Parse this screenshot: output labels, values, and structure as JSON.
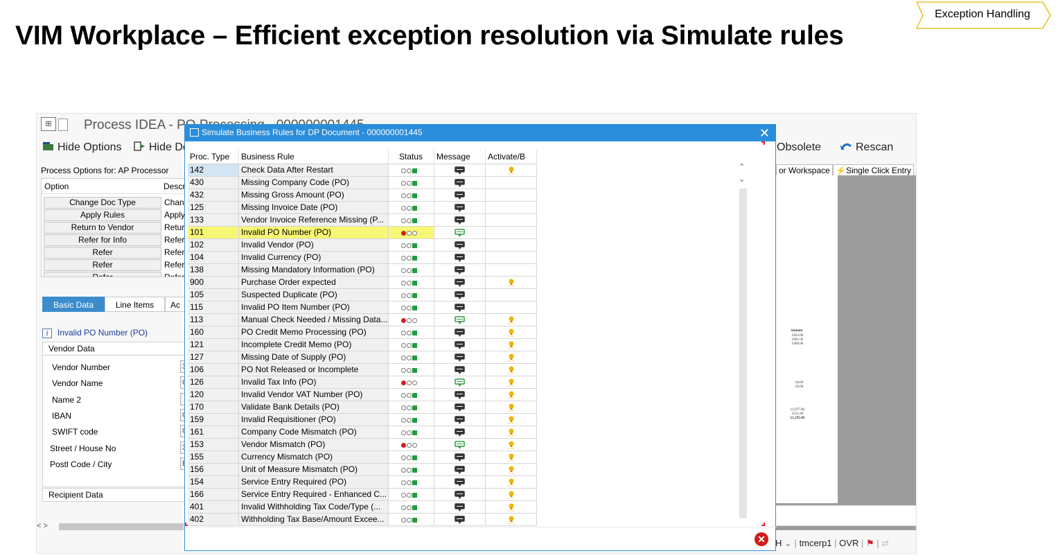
{
  "slide": {
    "title": "VIM Workplace – Efficient exception resolution via Simulate rules",
    "tag": "Exception Handling"
  },
  "background_window": {
    "title": "Process IDEA - PO Processing - 000000001445",
    "toolbar": {
      "hide_options": "Hide Options",
      "hide_details": "Hide De",
      "obsolete": "Obsolete",
      "rescan": "Rescan"
    },
    "process_options_label": "Process Options for: AP Processor",
    "options_header": {
      "option": "Option",
      "description": "Descr"
    },
    "options": [
      {
        "label": "Change Doc Type",
        "desc": "Chang"
      },
      {
        "label": "Apply Rules",
        "desc": "Apply"
      },
      {
        "label": "Return to Vendor",
        "desc": "Retur"
      },
      {
        "label": "Refer for Info",
        "desc": "Refer"
      },
      {
        "label": "Refer",
        "desc": "Refer"
      },
      {
        "label": "Refer",
        "desc": "Refer"
      },
      {
        "label": "Refer",
        "desc": "Refer"
      }
    ],
    "tabs": [
      "Basic Data",
      "Line Items",
      "Ac"
    ],
    "info_message": "Invalid PO Number (PO)",
    "vendor_section": "Vendor Data",
    "vendor_fields": [
      {
        "label": "Vendor Number",
        "value": "3"
      },
      {
        "label": "Vendor Name",
        "value": "C"
      },
      {
        "label": "Name 2",
        "value": ""
      },
      {
        "label": "IBAN",
        "value": "G"
      },
      {
        "label": "SWIFT code",
        "value": "C"
      },
      {
        "label": "Street / House No",
        "value": "3"
      },
      {
        "label": "Postl Code / City",
        "value": "E"
      }
    ],
    "recipient_section": "Recipient Data",
    "right_tabs": {
      "workspace": "or Workspace",
      "single_click": "Single Click Entry"
    },
    "status_bar": {
      "lang": "H",
      "system": "tmcerp1",
      "mode": "OVR"
    },
    "document_preview": {
      "amount_label": "Amount",
      "amounts_top": [
        "£833.00",
        "£691.00",
        "£400.00"
      ],
      "amounts_mid": [
        "£0.00",
        "£0.00"
      ],
      "amounts_bottom": [
        "£1,077.00",
        "£215.40",
        "£1,292.40"
      ]
    }
  },
  "dialog": {
    "title": "Simulate Business Rules for DP Document - 000000001445",
    "columns": [
      "Proc. Type",
      "Business Rule",
      "Status",
      "Message",
      "Activate/B"
    ],
    "rows": [
      {
        "type": "142",
        "rule": "Check Data After Restart",
        "status": "ok",
        "msg": "dark",
        "act": true
      },
      {
        "type": "430",
        "rule": "Missing Company Code (PO)",
        "status": "ok",
        "msg": "dark",
        "act": false
      },
      {
        "type": "432",
        "rule": "Missing Gross Amount (PO)",
        "status": "ok",
        "msg": "dark",
        "act": false
      },
      {
        "type": "125",
        "rule": "Missing Invoice Date (PO)",
        "status": "ok",
        "msg": "dark",
        "act": false
      },
      {
        "type": "133",
        "rule": "Vendor Invoice Reference Missing (P...",
        "status": "ok",
        "msg": "dark",
        "act": false
      },
      {
        "type": "101",
        "rule": "Invalid PO Number (PO)",
        "status": "error",
        "msg": "green",
        "act": false
      },
      {
        "type": "102",
        "rule": "Invalid Vendor (PO)",
        "status": "ok",
        "msg": "dark",
        "act": false
      },
      {
        "type": "104",
        "rule": "Invalid Currency (PO)",
        "status": "ok",
        "msg": "dark",
        "act": false
      },
      {
        "type": "138",
        "rule": "Missing Mandatory Information (PO)",
        "status": "ok",
        "msg": "dark",
        "act": false
      },
      {
        "type": "900",
        "rule": "Purchase Order expected",
        "status": "ok",
        "msg": "dark",
        "act": true
      },
      {
        "type": "105",
        "rule": "Suspected Duplicate (PO)",
        "status": "ok",
        "msg": "dark",
        "act": false
      },
      {
        "type": "115",
        "rule": "Invalid PO Item Number (PO)",
        "status": "ok",
        "msg": "dark",
        "act": false
      },
      {
        "type": "113",
        "rule": "Manual Check Needed / Missing Data...",
        "status": "error",
        "msg": "green",
        "act": true
      },
      {
        "type": "160",
        "rule": "PO Credit Memo Processing (PO)",
        "status": "ok",
        "msg": "dark",
        "act": true
      },
      {
        "type": "121",
        "rule": "Incomplete Credit Memo (PO)",
        "status": "ok",
        "msg": "dark",
        "act": true
      },
      {
        "type": "127",
        "rule": "Missing Date of Supply (PO)",
        "status": "ok",
        "msg": "dark",
        "act": true
      },
      {
        "type": "106",
        "rule": "PO Not Released or Incomplete",
        "status": "ok",
        "msg": "dark",
        "act": true
      },
      {
        "type": "126",
        "rule": "Invalid Tax Info (PO)",
        "status": "error",
        "msg": "green",
        "act": true
      },
      {
        "type": "120",
        "rule": "Invalid Vendor VAT Number (PO)",
        "status": "ok",
        "msg": "dark",
        "act": true
      },
      {
        "type": "170",
        "rule": "Validate Bank Details (PO)",
        "status": "ok",
        "msg": "dark",
        "act": true
      },
      {
        "type": "159",
        "rule": "Invalid Requisitioner (PO)",
        "status": "ok",
        "msg": "dark",
        "act": true
      },
      {
        "type": "161",
        "rule": "Company Code Mismatch (PO)",
        "status": "ok",
        "msg": "dark",
        "act": true
      },
      {
        "type": "153",
        "rule": "Vendor Mismatch (PO)",
        "status": "error",
        "msg": "green",
        "act": true
      },
      {
        "type": "155",
        "rule": "Currency Mismatch (PO)",
        "status": "ok",
        "msg": "dark",
        "act": true
      },
      {
        "type": "156",
        "rule": "Unit of Measure Mismatch (PO)",
        "status": "ok",
        "msg": "dark",
        "act": true
      },
      {
        "type": "154",
        "rule": "Service Entry Required (PO)",
        "status": "ok",
        "msg": "dark",
        "act": true
      },
      {
        "type": "166",
        "rule": "Service Entry Required - Enhanced C...",
        "status": "ok",
        "msg": "dark",
        "act": true
      },
      {
        "type": "401",
        "rule": "Invalid Withholding Tax Code/Type (...",
        "status": "ok",
        "msg": "dark",
        "act": true
      },
      {
        "type": "402",
        "rule": "Withholding Tax Base/Amount Excee...",
        "status": "ok",
        "msg": "dark",
        "act": true
      }
    ],
    "highlighted_row": "101",
    "selected_row": "142"
  },
  "colors": {
    "dialog_title_bg": "#2b8dd9",
    "highlight_row": "#f7f775",
    "status_red": "#d11f1f",
    "status_green": "#1f9d3a",
    "active_tab": "#3c8ccd"
  }
}
